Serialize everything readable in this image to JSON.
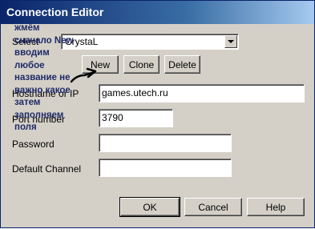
{
  "window": {
    "title": "Connection Editor"
  },
  "select": {
    "label": "Select",
    "value": "CrystaL"
  },
  "buttons": {
    "new": "New",
    "clone": "Clone",
    "delete": "Delete",
    "ok": "OK",
    "cancel": "Cancel",
    "help": "Help"
  },
  "fields": {
    "hostname": {
      "label": "Hostname or IP",
      "value": "games.utech.ru"
    },
    "port": {
      "label": "Port number",
      "value": "3790"
    },
    "password": {
      "label": "Password",
      "value": ""
    },
    "channel": {
      "label": "Default Channel",
      "value": ""
    }
  },
  "annotation": {
    "lines": [
      "жмём",
      "сначало New",
      "вводим",
      "любое",
      "название не",
      "важно какое",
      "затем",
      "заполняем",
      "поля"
    ]
  }
}
